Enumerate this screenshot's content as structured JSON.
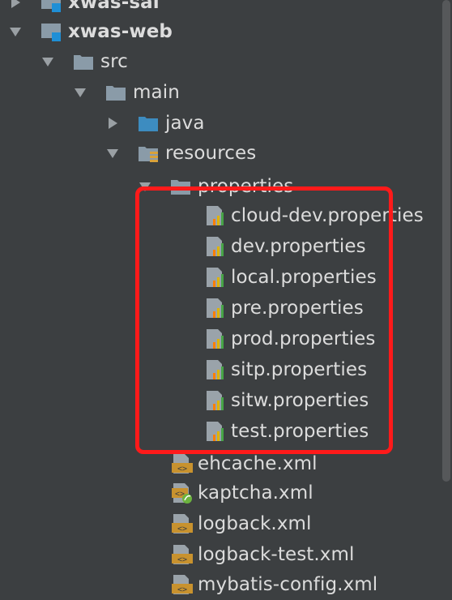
{
  "tree": {
    "xwas_sal": "xwas-sal",
    "xwas_web": "xwas-web",
    "src": "src",
    "main": "main",
    "java": "java",
    "resources": "resources",
    "properties": "properties",
    "property_files": [
      "cloud-dev.properties",
      "dev.properties",
      "local.properties",
      "pre.properties",
      "prod.properties",
      "sitp.properties",
      "sitw.properties",
      "test.properties"
    ],
    "xml_files": [
      "ehcache.xml",
      "kaptcha.xml",
      "logback.xml",
      "logback-test.xml",
      "mybatis-config.xml"
    ]
  },
  "colors": {
    "background": "#3c3f41",
    "text": "#dcdcdc",
    "folder": "#8a9ba8",
    "source_folder": "#3d8cc0",
    "highlight": "#ff1a1a"
  }
}
